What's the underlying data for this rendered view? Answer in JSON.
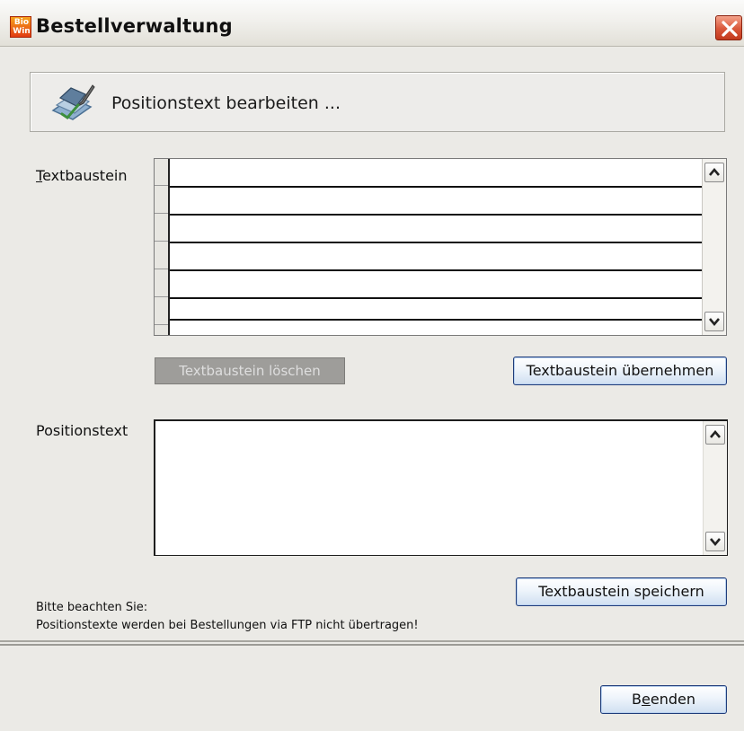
{
  "window": {
    "title": "Bestellverwaltung",
    "logo_top": "Bio",
    "logo_bottom": "Win"
  },
  "header": {
    "text": "Positionstext bearbeiten ..."
  },
  "textbaustein": {
    "label_mnemonic": "T",
    "label_rest": "extbaustein",
    "rows": 6,
    "delete_label": "Textbaustein löschen",
    "apply_label": "Textbaustein übernehmen"
  },
  "positionstext": {
    "label": "Positionstext",
    "value": "",
    "save_label": "Textbaustein speichern"
  },
  "notice": {
    "line1": "Bitte beachten Sie:",
    "line2": "Positionstexte werden bei Bestellungen via FTP nicht übertragen!"
  },
  "footer": {
    "close_pre": "B",
    "close_mnemonic": "e",
    "close_post": "enden"
  },
  "colors": {
    "accent": "#1f3c7a",
    "close": "#d9573a",
    "logo": "#e23b12"
  }
}
